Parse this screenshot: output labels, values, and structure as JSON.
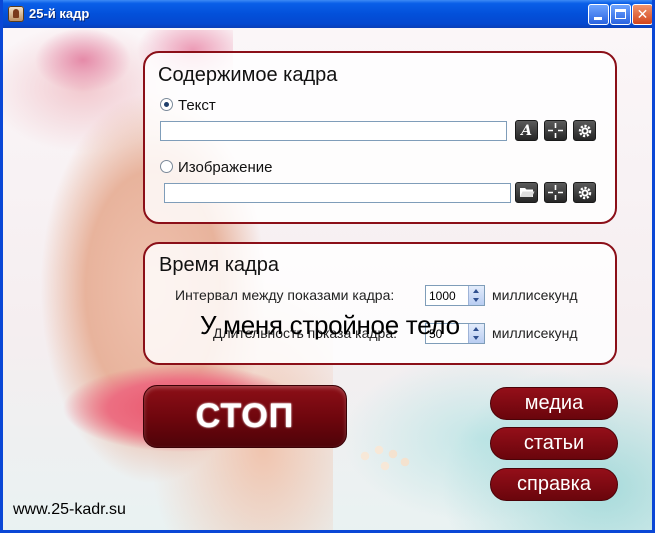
{
  "window": {
    "title": "25-й кадр",
    "icon": "app-icon",
    "controls": {
      "minimize": "minimize-icon",
      "maximize": "maximize-icon",
      "close": "close-icon"
    }
  },
  "content_panel": {
    "title": "Содержимое кадра",
    "text_option": {
      "label": "Текст",
      "selected": true,
      "value": ""
    },
    "image_option": {
      "label": "Изображение",
      "selected": false,
      "value": ""
    },
    "text_buttons": {
      "font": "A",
      "position": "crosshair-icon",
      "settings": "gear-icon"
    },
    "image_buttons": {
      "open": "folder-icon",
      "position": "crosshair-icon",
      "settings": "gear-icon"
    }
  },
  "time_panel": {
    "title": "Время кадра",
    "interval_label": "Интервал между показами кадра:",
    "interval_value": "1000",
    "interval_unit": "миллисекунд",
    "duration_label": "Длительность показа кадра:",
    "duration_value": "50",
    "duration_unit": "миллисекунд"
  },
  "overlay_message": "У меня стройное тело",
  "stop_button": "СТОП",
  "side_buttons": {
    "media": "медиа",
    "articles": "статьи",
    "help": "справка"
  },
  "site_link": "www.25-kadr.su",
  "colors": {
    "accent": "#8b0f18",
    "titlebar": "#0350da"
  }
}
